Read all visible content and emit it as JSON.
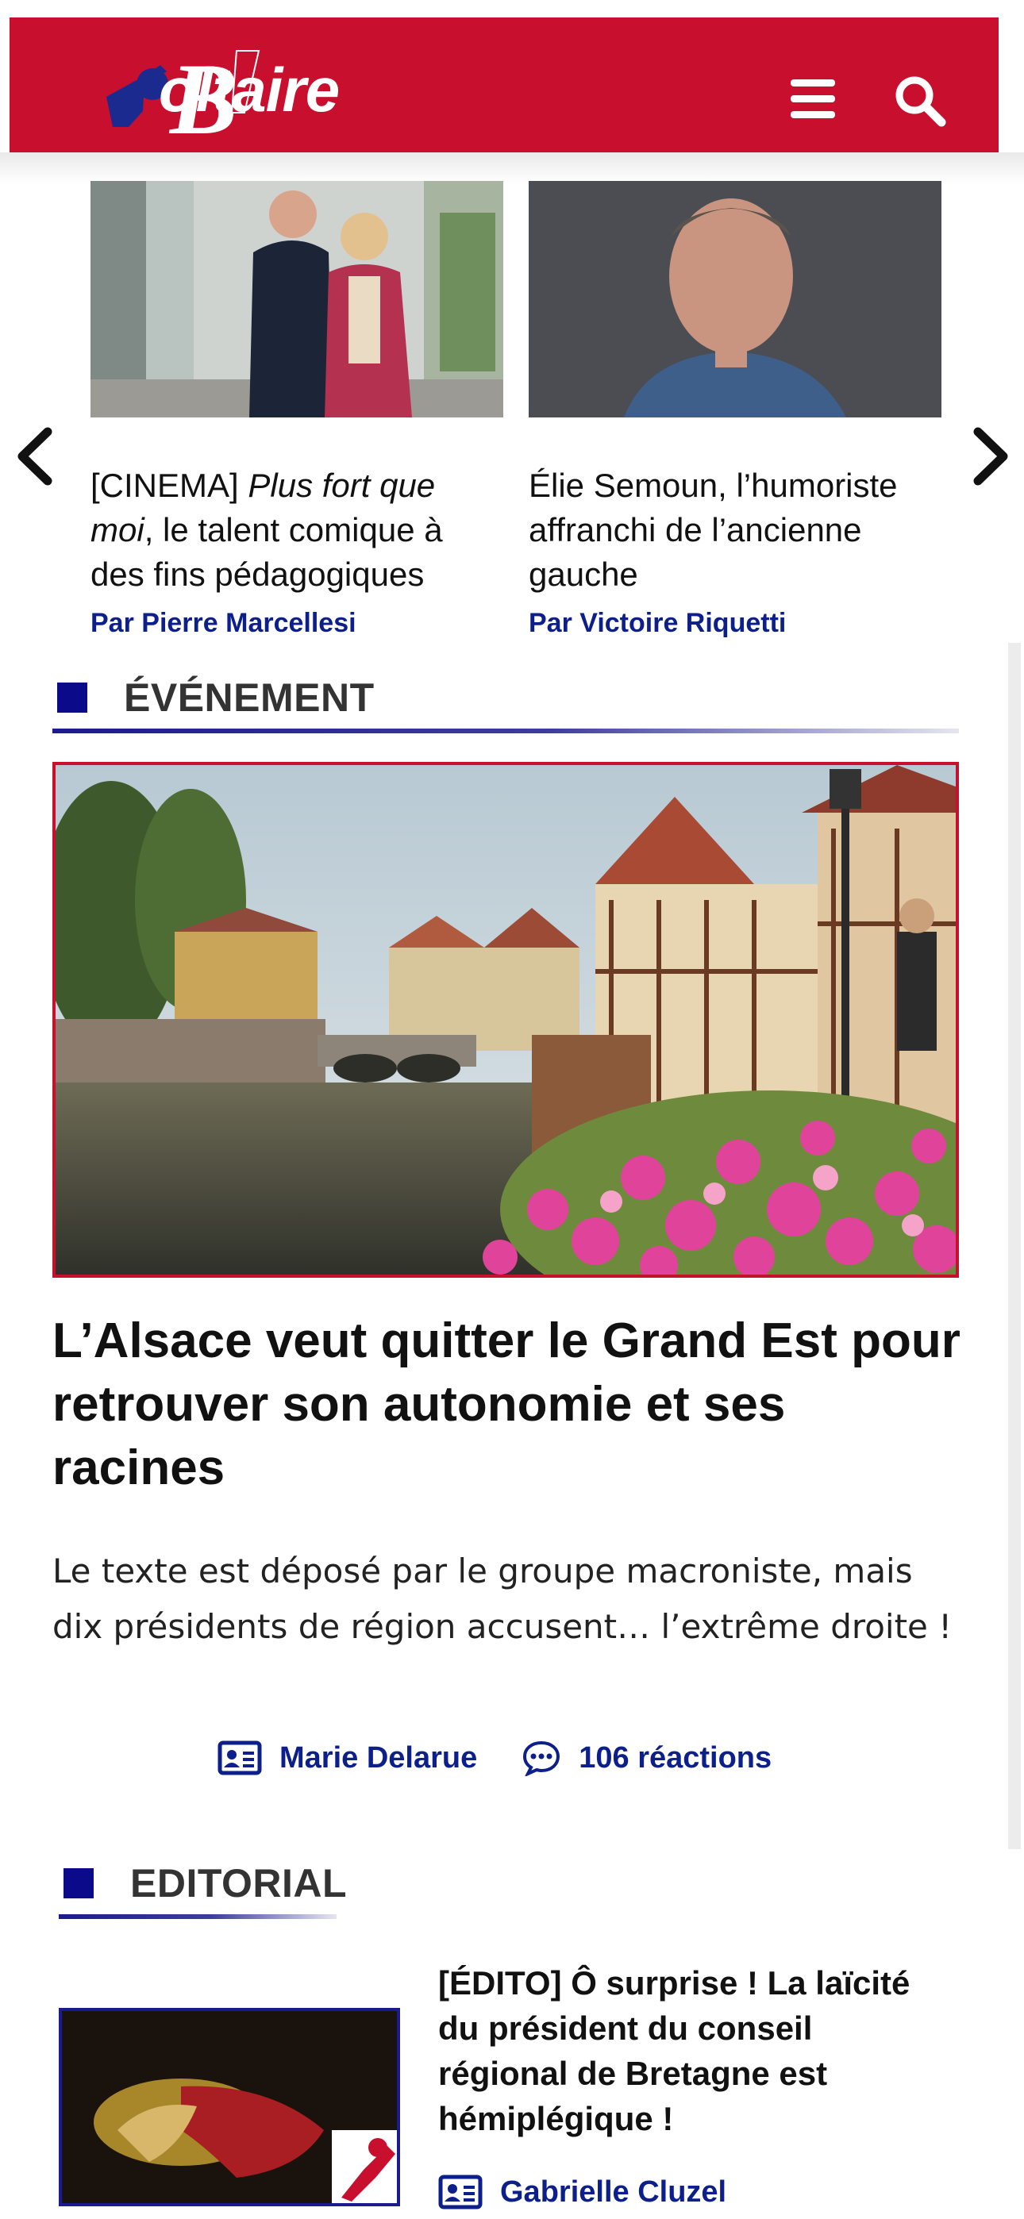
{
  "header": {
    "logo_text": "oltaire",
    "logo_letter": "B",
    "brand_color": "#c8102e",
    "menu_icon": "hamburger-icon",
    "search_icon": "search-icon"
  },
  "carousel": {
    "prev_icon": "chevron-left-icon",
    "next_icon": "chevron-right-icon",
    "cards": [
      {
        "title_prefix": "[CINEMA] ",
        "title_em": "Plus fort que moi",
        "title_rest": ", le talent comique à des fins pédagogiques",
        "author": "Par Pierre Marcellesi"
      },
      {
        "title": "Élie Semoun, l’humoriste affranchi de l’ancienne gauche",
        "author": "Par Victoire Riquetti"
      }
    ]
  },
  "event_section": {
    "label": "ÉVÉNEMENT",
    "title": "L’Alsace veut quitter le Grand Est pour retrouver son autonomie et ses racines",
    "description": "Le texte est déposé par le groupe macroniste, mais dix présidents de région accusent… l’extrême droite !",
    "author": "Marie Delarue",
    "reactions": "106 réactions"
  },
  "editorial_section": {
    "label": "EDITORIAL",
    "title": "[ÉDITO] Ô surprise ! La laïcité du président du conseil régional de Bretagne est hémiplégique !",
    "author": "Gabrielle Cluzel"
  },
  "colors": {
    "accent_blue": "#0c1f8a",
    "section_square": "#0a0a8a",
    "image_border_red": "#c8102e"
  }
}
